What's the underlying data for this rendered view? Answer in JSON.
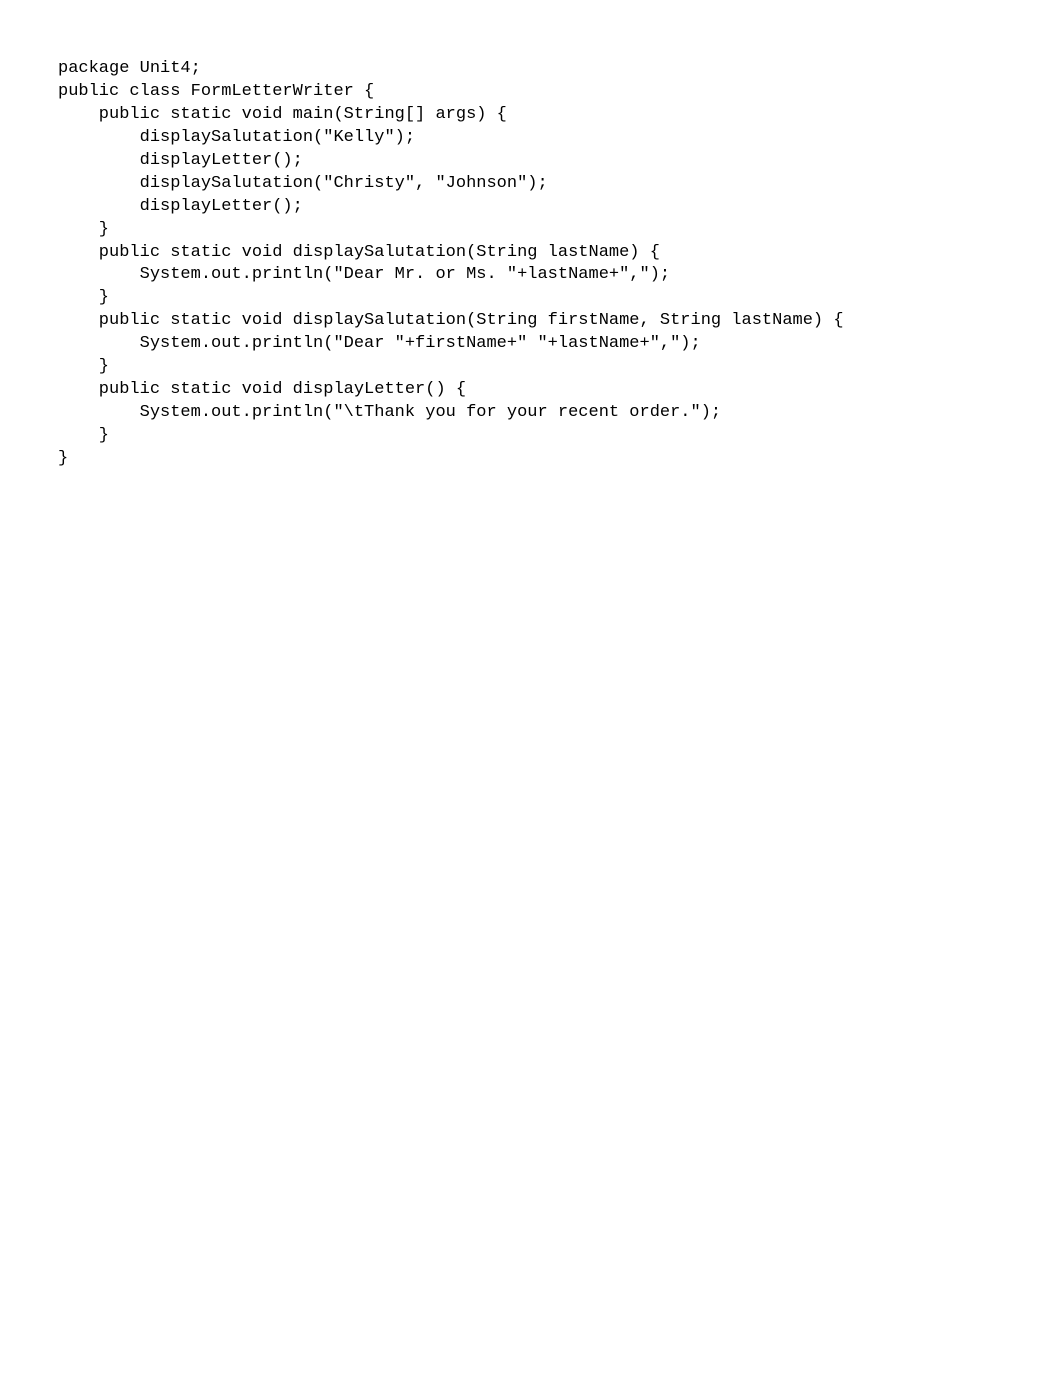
{
  "code": {
    "lines": [
      "package Unit4;",
      "",
      "public class FormLetterWriter {",
      "    public static void main(String[] args) {",
      "        displaySalutation(\"Kelly\");",
      "        displayLetter();",
      "        displaySalutation(\"Christy\", \"Johnson\");",
      "        displayLetter();",
      "    }",
      "",
      "    public static void displaySalutation(String lastName) {",
      "        System.out.println(\"Dear Mr. or Ms. \"+lastName+\",\");",
      "    }",
      "",
      "    public static void displaySalutation(String firstName, String lastName) {",
      "        System.out.println(\"Dear \"+firstName+\" \"+lastName+\",\");",
      "    }",
      "",
      "    public static void displayLetter() {",
      "        System.out.println(\"\\tThank you for your recent order.\");",
      "    }",
      "}"
    ]
  }
}
